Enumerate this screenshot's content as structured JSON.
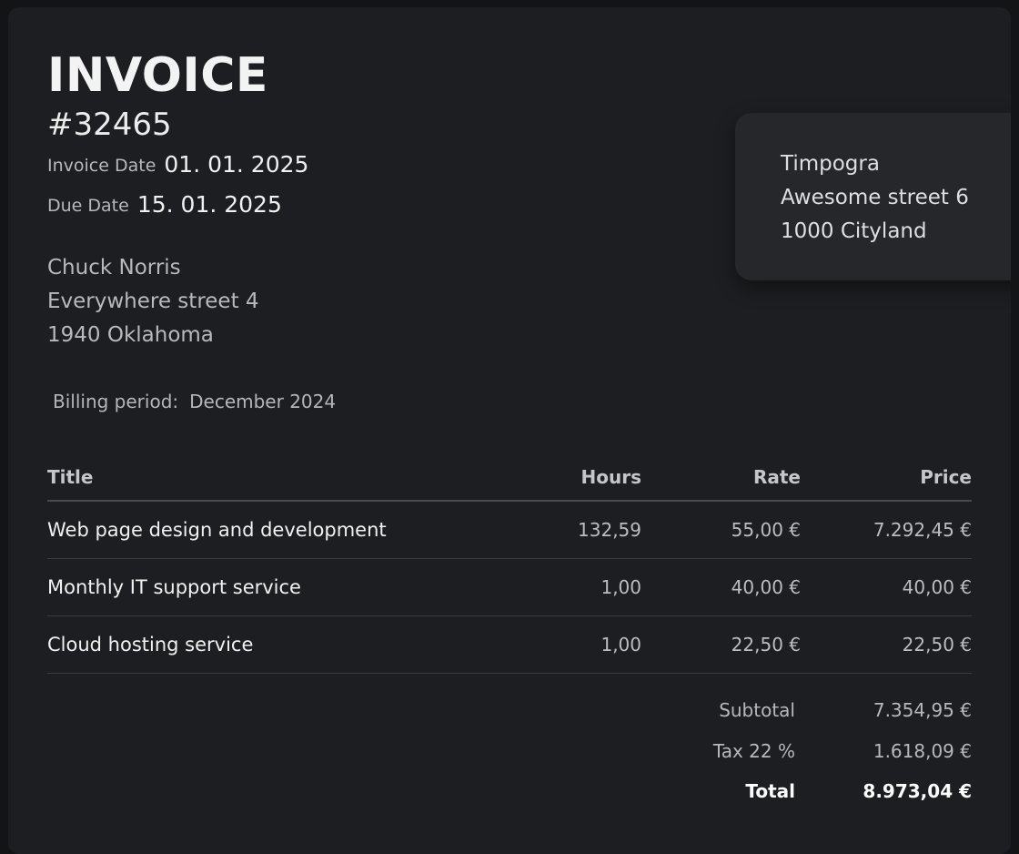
{
  "invoice": {
    "title": "INVOICE",
    "number": "#32465",
    "invoice_date_label": "Invoice Date",
    "invoice_date": "01. 01. 2025",
    "due_date_label": "Due Date",
    "due_date": "15. 01. 2025"
  },
  "client": {
    "name": "Chuck Norris",
    "street": "Everywhere street 4",
    "city": "1940 Oklahoma"
  },
  "sender": {
    "name": "Timpogra",
    "street": "Awesome street 6",
    "city": "1000 Cityland"
  },
  "billing": {
    "label": "Billing period:",
    "value": "December 2024"
  },
  "table": {
    "headers": {
      "title": "Title",
      "hours": "Hours",
      "rate": "Rate",
      "price": "Price"
    },
    "rows": [
      {
        "title": "Web page design and development",
        "hours": "132,59",
        "rate": "55,00 €",
        "price": "7.292,45 €"
      },
      {
        "title": "Monthly IT support service",
        "hours": "1,00",
        "rate": "40,00 €",
        "price": "40,00 €"
      },
      {
        "title": "Cloud hosting service",
        "hours": "1,00",
        "rate": "22,50 €",
        "price": "22,50 €"
      }
    ]
  },
  "totals": {
    "subtotal_label": "Subtotal",
    "subtotal": "7.354,95 €",
    "tax_label": "Tax 22 %",
    "tax": "1.618,09 €",
    "total_label": "Total",
    "total": "8.973,04 €"
  },
  "colors": {
    "background": "#141416",
    "sheet": "#1d1e21",
    "card": "#26272b",
    "text_primary": "#f1f1f1",
    "text_secondary": "#b8b8bc"
  }
}
